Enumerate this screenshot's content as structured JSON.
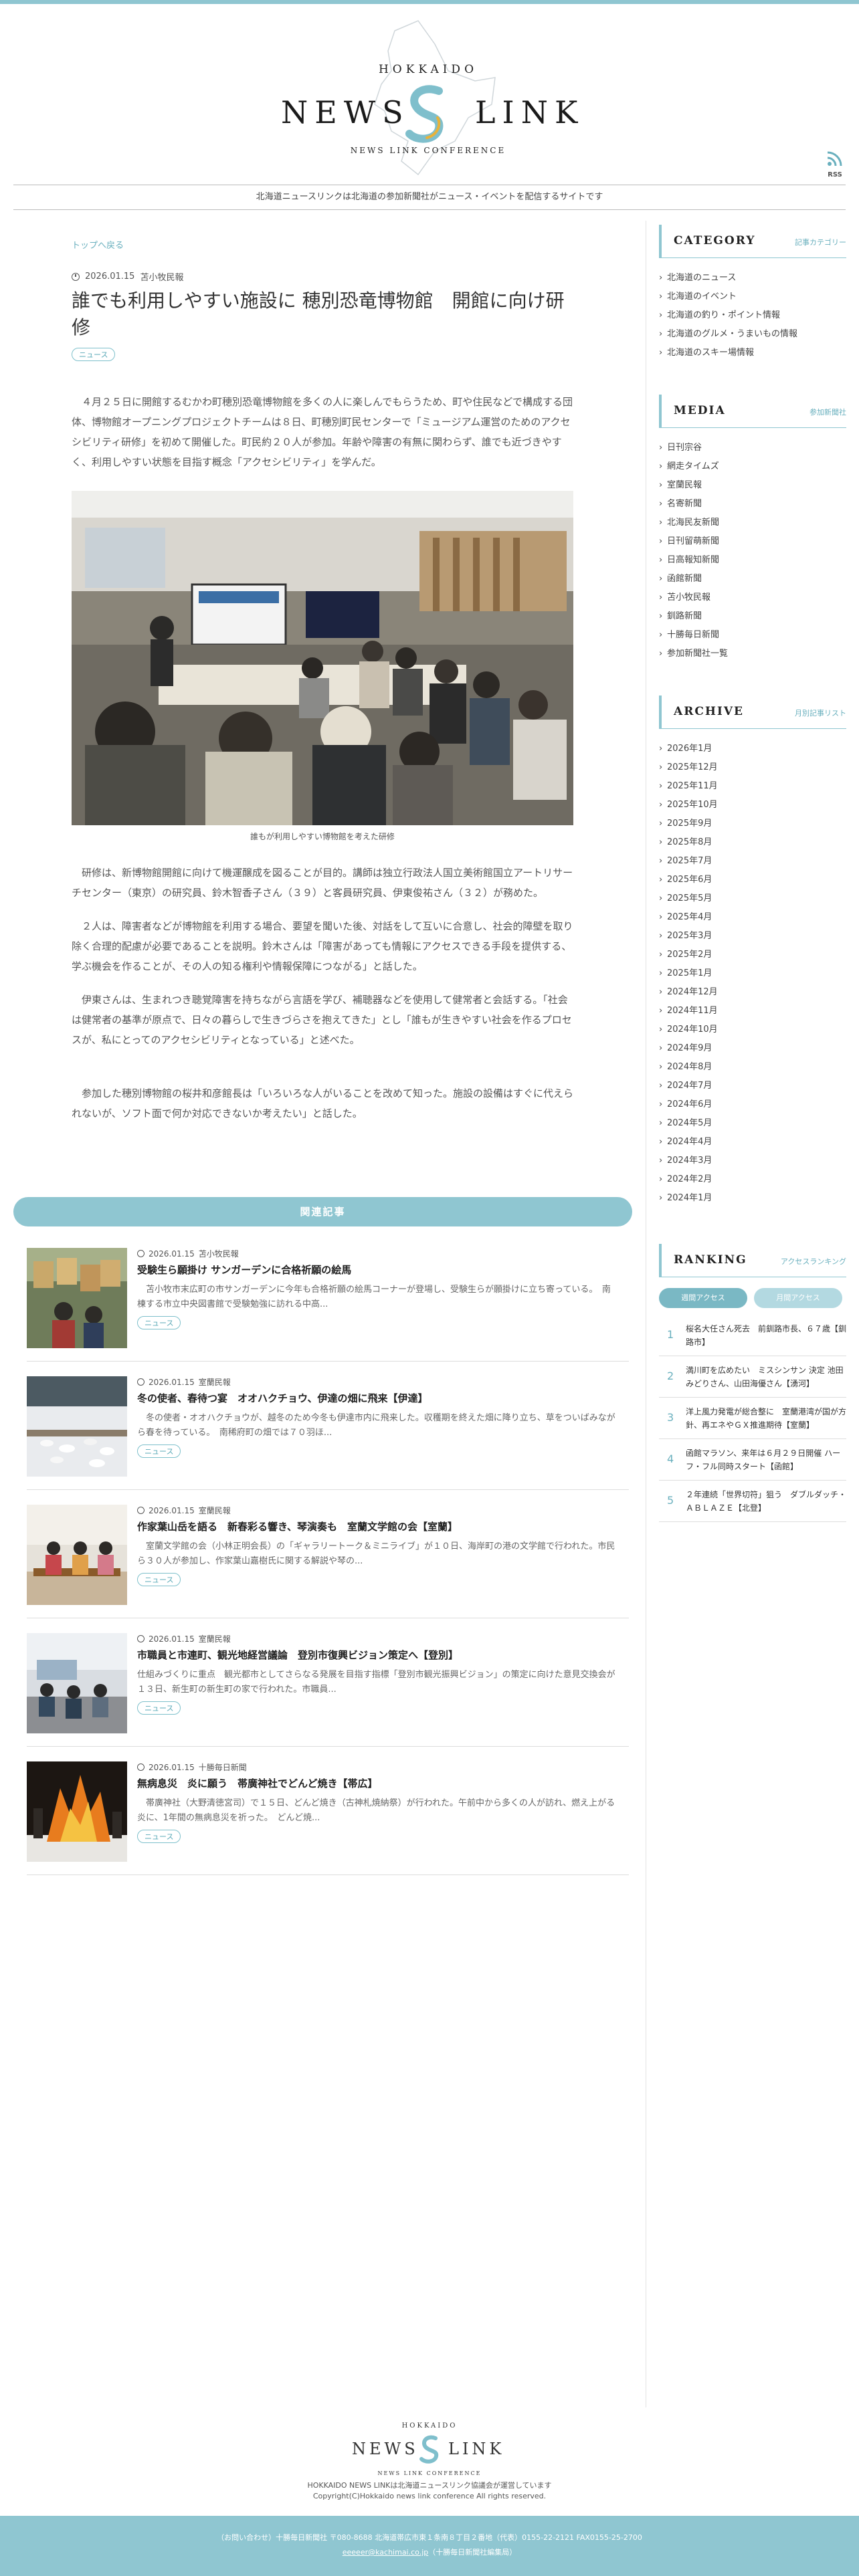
{
  "brand": {
    "hokkaido": "HOKKAIDO",
    "news": "NEWS",
    "link": "LINK",
    "conference": "NEWS LINK CONFERENCE",
    "rss_label": "RSS",
    "tagline": "北海道ニュースリンクは北海道の参加新聞社がニュース・イベントを配信するサイトです"
  },
  "article": {
    "breadcrumb": "トップへ戻る",
    "date": "2026.01.15",
    "source": "苫小牧民報",
    "title": "誰でも利用しやすい施設に 穂別恐竜博物館　開館に向け研修",
    "tag": "ニュース",
    "paragraphs": [
      "　４月２５日に開館するむかわ町穂別恐竜博物館を多くの人に楽しんでもらうため、町や住民などで構成する団体、博物館オープニングプロジェクトチームは８日、町穂別町民センターで「ミュージアム運営のためのアクセシビリティ研修」を初めて開催した。町民約２０人が参加。年齢や障害の有無に関わらず、誰でも近づきやすく、利用しやすい状態を目指す概念「アクセシビリティ」を学んだ。",
      "　研修は、新博物館開館に向けて機運醸成を図ることが目的。講師は独立行政法人国立美術館国立アートリサーチセンター（東京）の研究員、鈴木智香子さん（３９）と客員研究員、伊東俊祐さん（３２）が務めた。",
      "　２人は、障害者などが博物館を利用する場合、要望を聞いた後、対話をして互いに合意し、社会的障壁を取り除く合理的配慮が必要であることを説明。鈴木さんは「障害があっても情報にアクセスできる手段を提供する、学ぶ機会を作ることが、その人の知る権利や情報保障につながる」と話した。",
      "　伊東さんは、生まれつき聴覚障害を持ちながら言語を学び、補聴器などを使用して健常者と会話する。「社会は健常者の基準が原点で、日々の暮らしで生きづらさを抱えてきた」とし「誰もが生きやすい社会を作るプロセスが、私にとってのアクセシビリティとなっている」と述べた。",
      "　参加した穂別博物館の桜井和彦館長は「いろいろな人がいることを改めて知った。施設の設備はすぐに代えられないが、ソフト面で何か対応できないか考えたい」と話した。"
    ],
    "photo_caption": "誰もが利用しやすい博物館を考えた研修"
  },
  "related": {
    "heading": "関連記事",
    "items": [
      {
        "date": "2026.01.15",
        "source": "苫小牧民報",
        "title": "受験生ら願掛け サンガーデンに合格祈願の絵馬",
        "excerpt": "　苫小牧市末広町の市サンガーデンに今年も合格祈願の絵馬コーナーが登場し、受験生らが願掛けに立ち寄っている。　南棟する市立中央図書館で受験勉強に訪れる中高...",
        "tag": "ニュース"
      },
      {
        "date": "2026.01.15",
        "source": "室蘭民報",
        "title": "冬の使者、春待つ宴　オオハクチョウ、伊達の畑に飛来【伊達】",
        "excerpt": "　冬の使者・オオハクチョウが、越冬のため今冬も伊達市内に飛来した。収穫期を終えた畑に降り立ち、草をついばみながら春を待っている。　南稀府町の畑では７０羽ほ...",
        "tag": "ニュース"
      },
      {
        "date": "2026.01.15",
        "source": "室蘭民報",
        "title": "作家葉山岳を語る　新春彩る響き、琴演奏も　室蘭文学館の会【室蘭】",
        "excerpt": "　室蘭文学館の会（小林正明会長）の「ギャラリートーク＆ミニライブ」が１０日、海岸町の港の文学館で行われた。市民ら３０人が参加し、作家葉山嘉樹氏に関する解説や琴の...",
        "tag": "ニュース"
      },
      {
        "date": "2026.01.15",
        "source": "室蘭民報",
        "title": "市職員と市連町、観光地経営議論　登別市復興ビジョン策定へ【登別】",
        "excerpt": "仕組みづくりに重点　観光都市としてさらなる発展を目指す指標「登別市観光振興ビジョン」の策定に向けた意見交換会が１３日、新生町の新生町の家で行われた。市職員...",
        "tag": "ニュース"
      },
      {
        "date": "2026.01.15",
        "source": "十勝毎日新聞",
        "title": "無病息災　炎に願う　帯廣神社でどんど焼き【帯広】",
        "excerpt": "　帯廣神社（大野清徳宮司）で１５日、どんど焼き（古神札焼納祭）が行われた。午前中から多くの人が訪れ、燃え上がる炎に、1年間の無病息災を祈った。　どんど焼...",
        "tag": "ニュース"
      }
    ]
  },
  "sidebar": {
    "category": {
      "heading": "CATEGORY",
      "sub": "記事カテゴリー",
      "items": [
        "北海道のニュース",
        "北海道のイベント",
        "北海道の釣り・ポイント情報",
        "北海道のグルメ・うまいもの情報",
        "北海道のスキー場情報"
      ]
    },
    "media": {
      "heading": "MEDIA",
      "sub": "参加新聞社",
      "items": [
        "日刊宗谷",
        "網走タイムズ",
        "室蘭民報",
        "名寄新聞",
        "北海民友新聞",
        "日刊留萌新聞",
        "日高報知新聞",
        "函館新聞",
        "苫小牧民報",
        "釧路新聞",
        "十勝毎日新聞",
        "参加新聞社一覧"
      ]
    },
    "archive": {
      "heading": "ARCHIVE",
      "sub": "月別記事リスト",
      "items": [
        "2026年1月",
        "2025年12月",
        "2025年11月",
        "2025年10月",
        "2025年9月",
        "2025年8月",
        "2025年7月",
        "2025年6月",
        "2025年5月",
        "2025年4月",
        "2025年3月",
        "2025年2月",
        "2025年1月",
        "2024年12月",
        "2024年11月",
        "2024年10月",
        "2024年9月",
        "2024年8月",
        "2024年7月",
        "2024年6月",
        "2024年5月",
        "2024年4月",
        "2024年3月",
        "2024年2月",
        "2024年1月"
      ]
    },
    "ranking": {
      "heading": "RANKING",
      "sub": "アクセスランキング",
      "tab_weekly": "週間アクセス",
      "tab_monthly": "月間アクセス",
      "items": [
        {
          "no": "1",
          "title": "桜名大任さん死去　前釧路市長、６７歳【釧路市】"
        },
        {
          "no": "2",
          "title": "満川町を広めたい　ミスシンサン 決定 池田みどりさん、山田海優さん【湧河】"
        },
        {
          "no": "3",
          "title": "洋上風力発電が総合整に　室蘭港湾が国が方針、再エネやＧＸ推進期待【室蘭】"
        },
        {
          "no": "4",
          "title": "函館マラソン、来年は６月２９日開催 ハーフ・フル同時スタート【函館】"
        },
        {
          "no": "5",
          "title": "２年連続「世界切符」狙う　ダブルダッチ・ＡＢＬＡＺＥ【北登】"
        }
      ]
    }
  },
  "footer": {
    "hokkaido": "HOKKAIDO",
    "news": "NEWS",
    "link": "LINK",
    "conference": "NEWS LINK CONFERENCE",
    "line1": "HOKKAIDO NEWS LINKは北海道ニュースリンク協議会が運営しています",
    "copyright": "Copyright(C)Hokkaido news link conference All rights reserved.",
    "contact": "（お問い合わせ）十勝毎日新聞社 〒080-8688 北海道帯広市東１条南８丁目２番地（代表）0155-22-2121 FAX0155-25-2700",
    "email": "eeeeer@kachimai.co.jp",
    "email_note": "（十勝毎日新聞社編集局）"
  },
  "colors": {
    "accent": "#8fc6d1",
    "accent_text": "#6ab0be",
    "rank_tab_weekly": "#7ab8c4",
    "rank_tab_monthly": "#b3d9e1"
  }
}
